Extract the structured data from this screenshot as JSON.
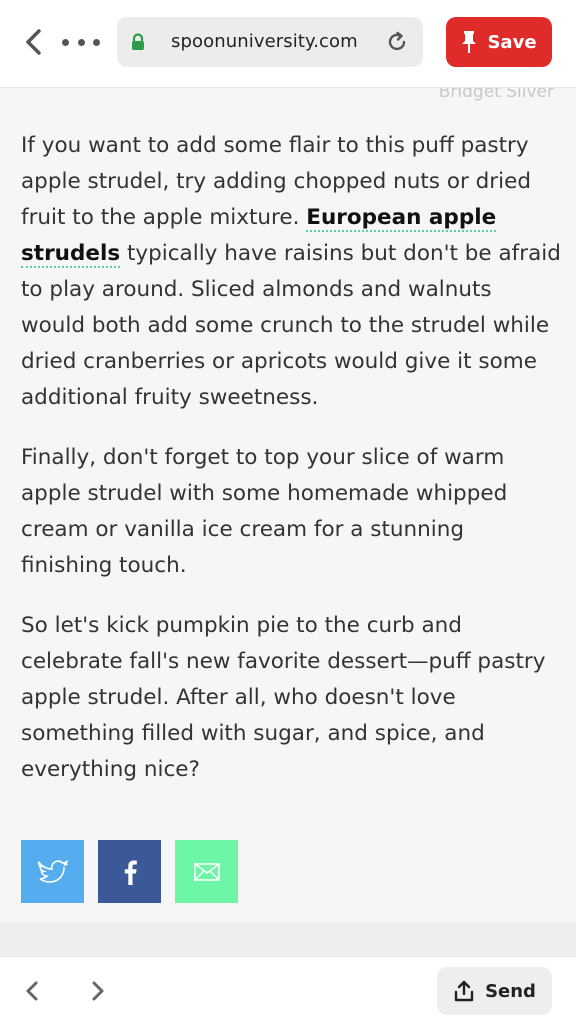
{
  "browser": {
    "url": "spoonuniversity.com",
    "save_label": "Save",
    "send_label": "Send"
  },
  "article": {
    "photo_credit": "Bridget Silver",
    "p1_before": "If you want to add some flair to this puff pastry apple strudel, try adding chopped nuts or dried fruit to the apple mixture. ",
    "p1_link": "European apple strudels",
    "p1_after": " typically have raisins but don't be afraid to play around. Sliced almonds and walnuts would both add some crunch to the strudel while dried cranberries or apricots would give it some additional fruity sweetness.",
    "p2": "Finally, don't forget to top your slice of warm apple strudel with some homemade whipped cream or vanilla ice cream for a stunning finishing touch.",
    "p3": "So let's kick pumpkin pie to the curb and celebrate fall's new favorite dessert—puff pastry apple strudel. After all, who doesn't love something filled with sugar, and spice, and everything nice?"
  },
  "share": {
    "twitter_icon": "twitter-bird-icon",
    "facebook_icon": "facebook-f-icon",
    "email_icon": "envelope-icon",
    "colors": {
      "twitter": "#55acee",
      "facebook": "#3b5998",
      "email": "#6cf6a5"
    }
  },
  "colors": {
    "save": "#e02b2b",
    "link_underline": "#5ad39a"
  }
}
